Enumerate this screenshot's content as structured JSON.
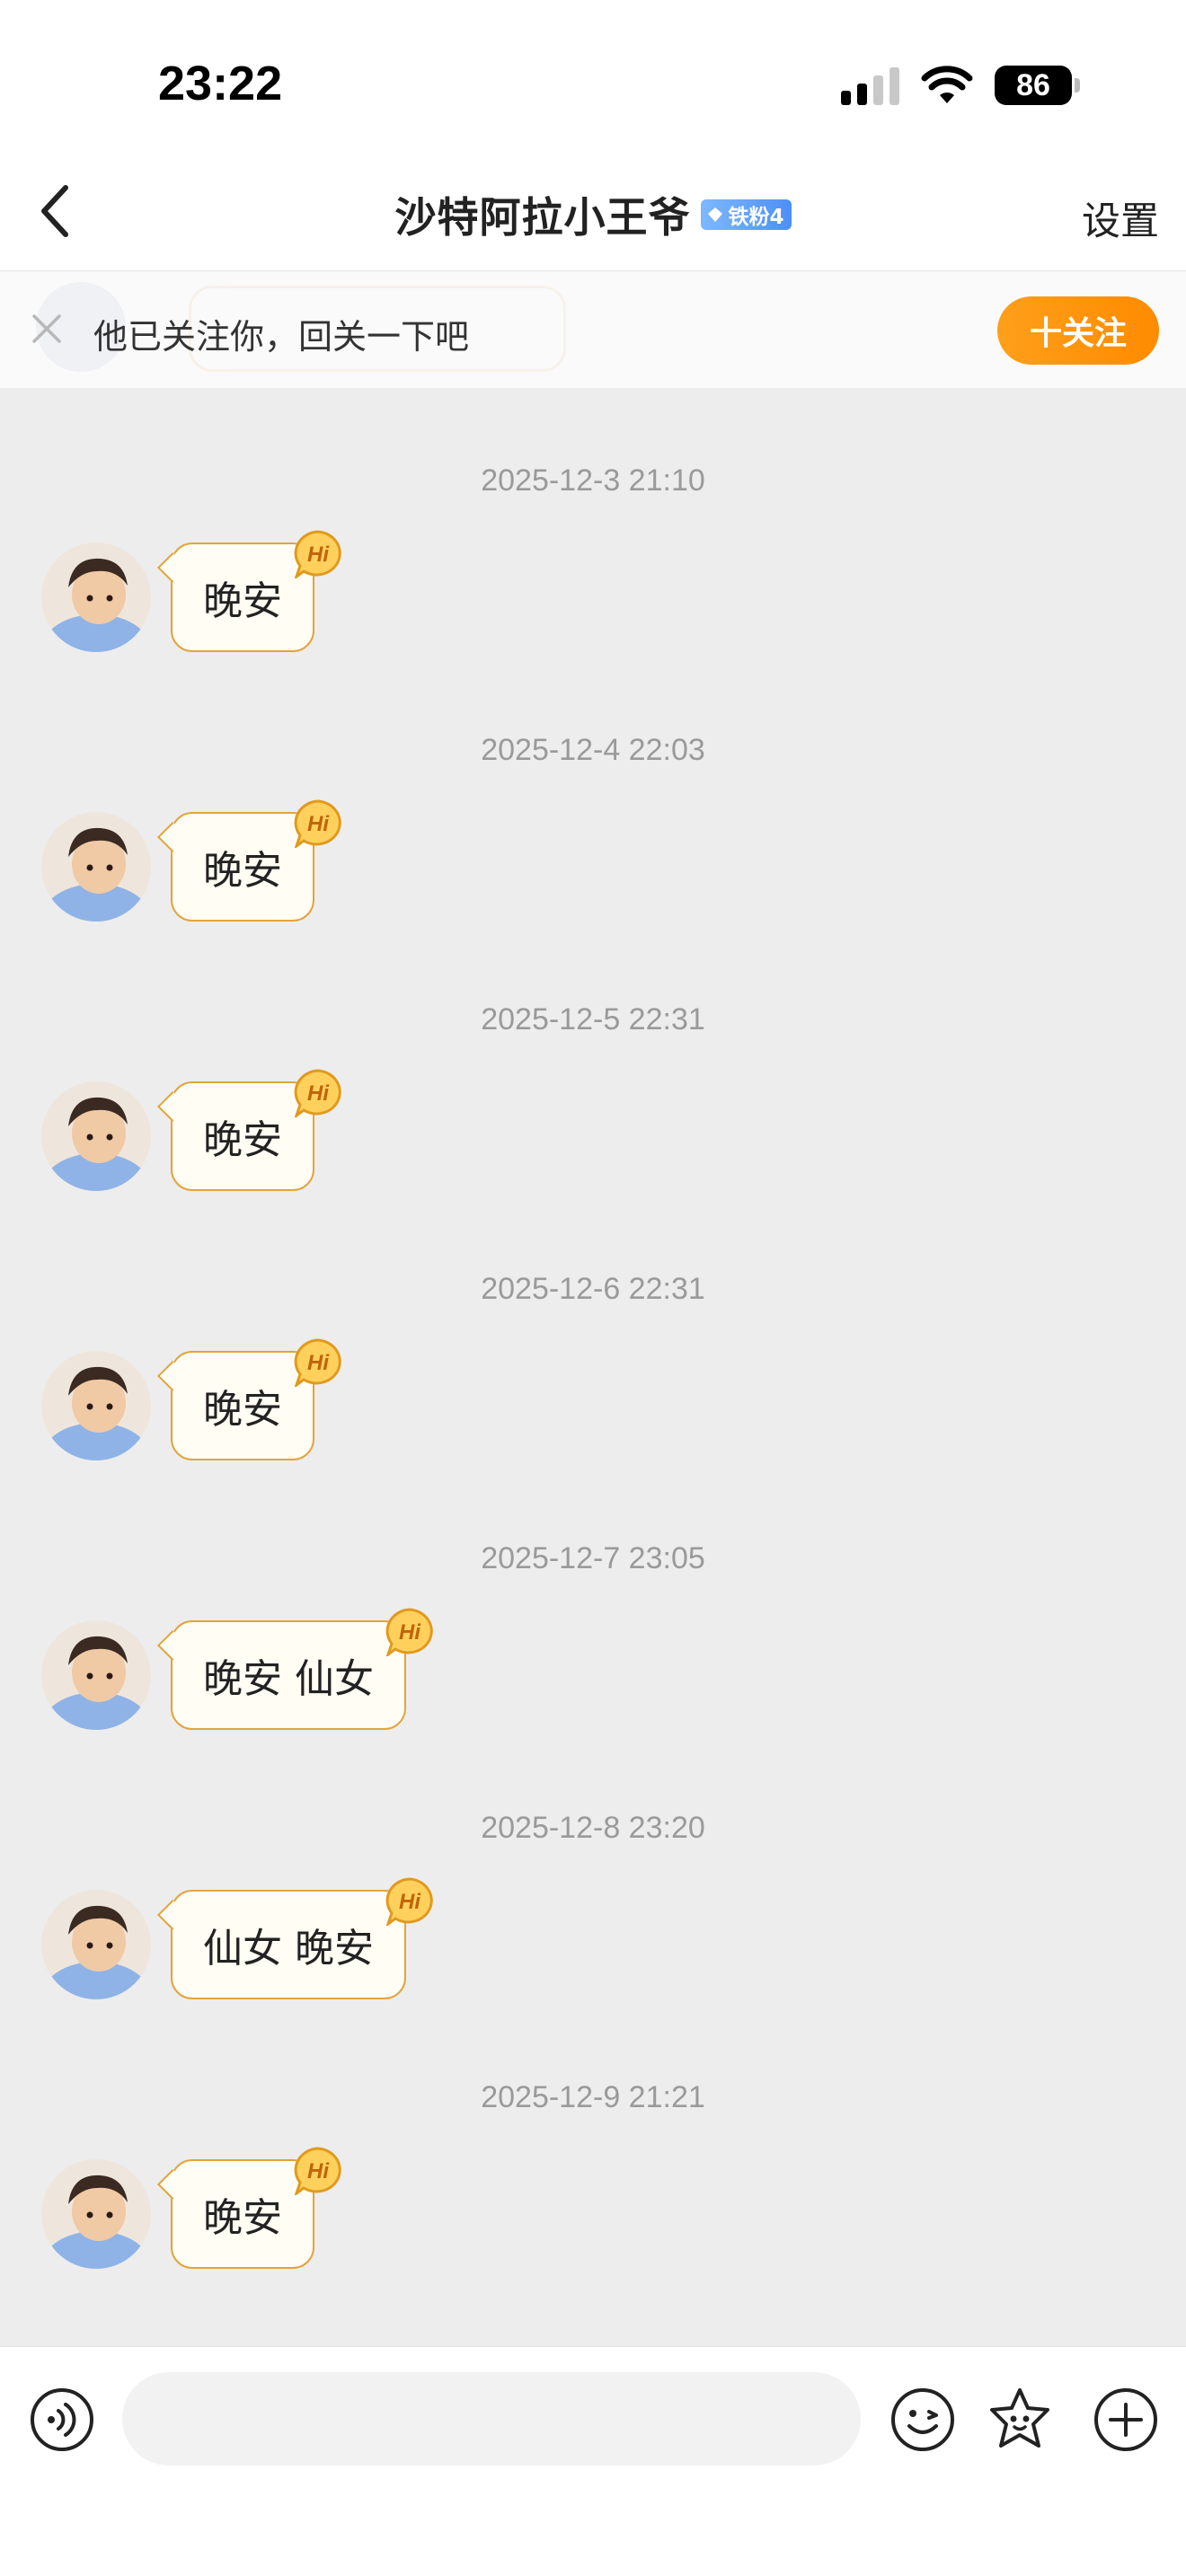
{
  "status_bar": {
    "time": "23:22",
    "battery": "86"
  },
  "header": {
    "title": "沙特阿拉小王爷",
    "fan_badge": "铁粉4",
    "settings_label": "设置"
  },
  "follow_bar": {
    "text": "他已关注你，回关一下吧",
    "button_label": "十关注"
  },
  "messages": [
    {
      "timestamp": "2025-12-3 21:10",
      "text": "晚安"
    },
    {
      "timestamp": "2025-12-4 22:03",
      "text": "晚安"
    },
    {
      "timestamp": "2025-12-5 22:31",
      "text": "晚安"
    },
    {
      "timestamp": "2025-12-6 22:31",
      "text": "晚安"
    },
    {
      "timestamp": "2025-12-7 23:05",
      "text": "晚安 仙女"
    },
    {
      "timestamp": "2025-12-8 23:20",
      "text": "仙女 晚安"
    },
    {
      "timestamp": "2025-12-9 21:21",
      "text": "晚安"
    }
  ],
  "hi_label": "Hi",
  "icons": {
    "back": "chevron-left-icon",
    "close": "close-icon",
    "voice": "voice-icon",
    "emoji": "smiley-icon",
    "sticker": "sticker-icon",
    "plus": "plus-icon",
    "signal": "cellular-signal-icon",
    "wifi": "wifi-icon",
    "battery": "battery-icon"
  },
  "colors": {
    "accent_orange": "#ff9200",
    "bubble_border": "#e2a43c",
    "chat_background": "#ededed"
  }
}
